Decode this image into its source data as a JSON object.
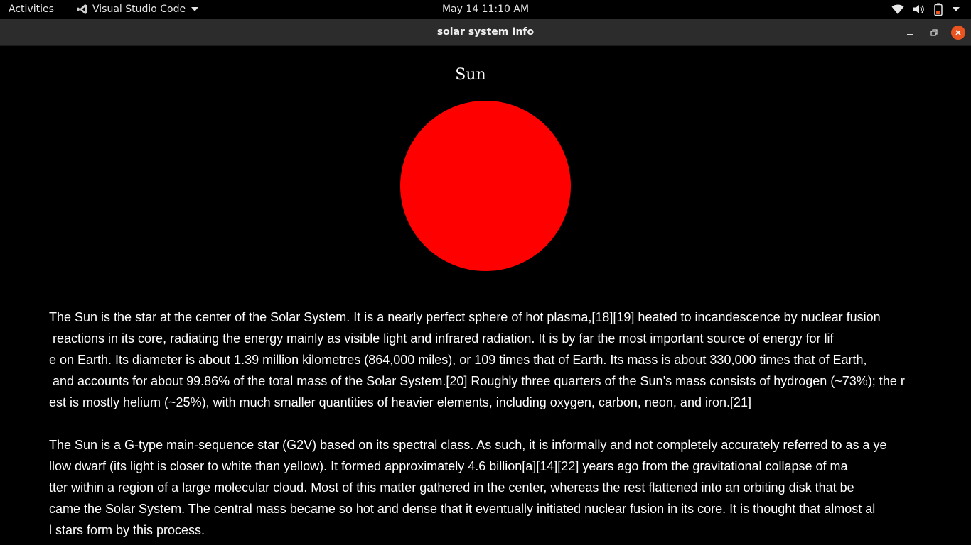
{
  "topbar": {
    "activities": "Activities",
    "app_name": "Visual Studio Code",
    "datetime": "May 14  11:10 AM",
    "icons": [
      "wifi-icon",
      "volume-icon",
      "battery-icon",
      "system-menu-chevron-icon"
    ]
  },
  "window": {
    "title": "solar system Info",
    "controls": [
      "minimize-icon",
      "maximize-icon",
      "close-icon"
    ]
  },
  "page": {
    "heading": "Sun",
    "sun_color": "#ff0000",
    "paragraph1": [
      "The Sun is the star at the center of the Solar System. It is a nearly perfect sphere of hot plasma,[18][19] heated to incandescence by nuclear fusion",
      " reactions in its core, radiating the energy mainly as visible light and infrared radiation. It is by far the most important source of energy for lif",
      "e on Earth. Its diameter is about 1.39 million kilometres (864,000 miles), or 109 times that of Earth. Its mass is about 330,000 times that of Earth,",
      " and accounts for about 99.86% of the total mass of the Solar System.[20] Roughly three quarters of the Sun’s mass consists of hydrogen (~73%); the r",
      "est is mostly helium (~25%), with much smaller quantities of heavier elements, including oxygen, carbon, neon, and iron.[21]"
    ],
    "paragraph2": [
      "The Sun is a G-type main-sequence star (G2V) based on its spectral class. As such, it is informally and not completely accurately referred to as a ye",
      "llow dwarf (its light is closer to white than yellow). It formed approximately 4.6 billion[a][14][22] years ago from the gravitational collapse of ma",
      "tter within a region of a large molecular cloud. Most of this matter gathered in the center, whereas the rest flattened into an orbiting disk that be",
      "came the Solar System. The central mass became so hot and dense that it eventually initiated nuclear fusion in its core. It is thought that almost al",
      "l stars form by this process."
    ]
  }
}
